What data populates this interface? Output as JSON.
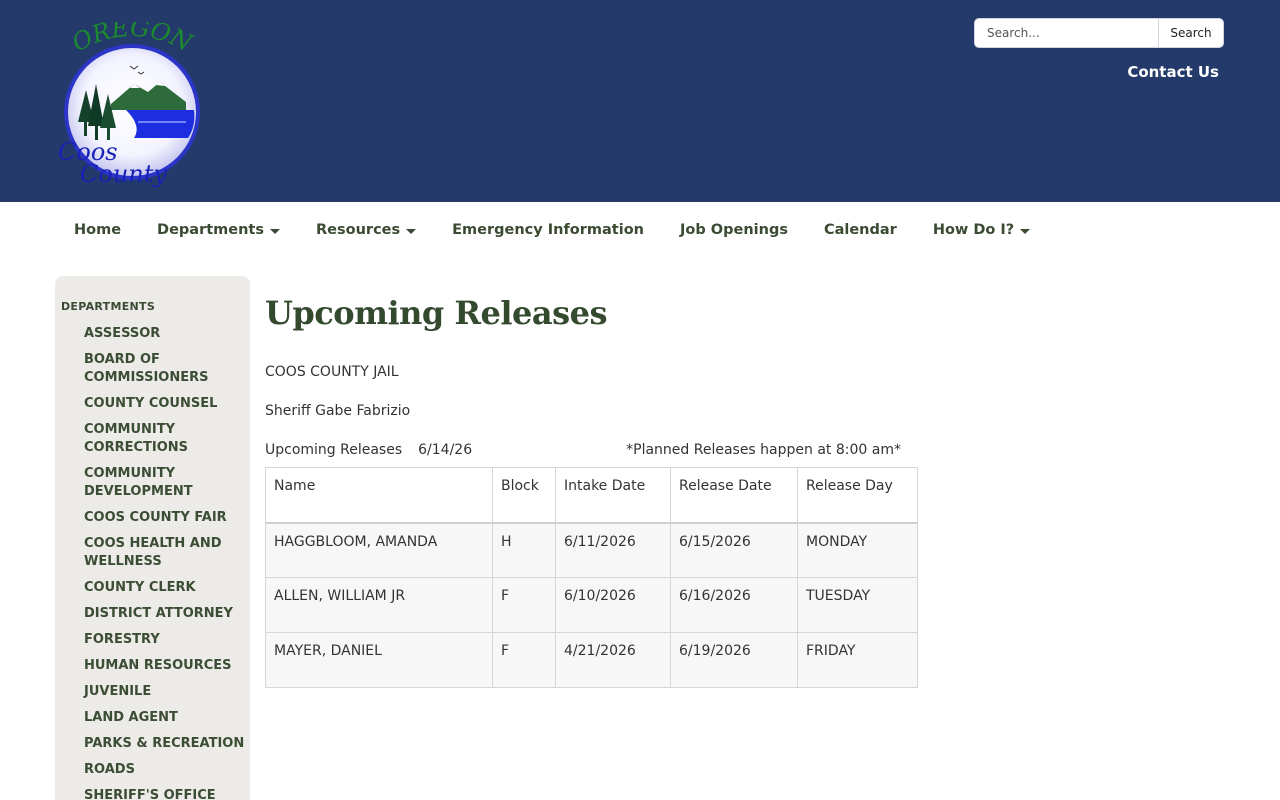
{
  "header": {
    "logo": {
      "top_text": "OREGON",
      "line1": "Coos",
      "line2": "County"
    },
    "search": {
      "placeholder": "Search...",
      "button_label": "Search"
    },
    "contact_label": "Contact Us"
  },
  "nav": {
    "items": [
      {
        "label": "Home",
        "dropdown": false
      },
      {
        "label": "Departments",
        "dropdown": true
      },
      {
        "label": "Resources",
        "dropdown": true
      },
      {
        "label": "Emergency Information",
        "dropdown": false
      },
      {
        "label": "Job Openings",
        "dropdown": false
      },
      {
        "label": "Calendar",
        "dropdown": false
      },
      {
        "label": "How Do I?",
        "dropdown": true
      }
    ]
  },
  "sidebar": {
    "title": "DEPARTMENTS",
    "items": [
      "ASSESSOR",
      "BOARD OF COMMISSIONERS",
      "COUNTY COUNSEL",
      "COMMUNITY CORRECTIONS",
      "COMMUNITY DEVELOPMENT",
      "COOS COUNTY FAIR",
      "COOS HEALTH AND WELLNESS",
      "COUNTY CLERK",
      "DISTRICT ATTORNEY",
      "FORESTRY",
      "HUMAN RESOURCES",
      "JUVENILE",
      "LAND AGENT",
      "PARKS & RECREATION",
      "ROADS",
      "SHERIFF'S OFFICE"
    ]
  },
  "main": {
    "title": "Upcoming Releases",
    "jail": "COOS COUNTY JAIL",
    "sheriff": "Sheriff Gabe Fabrizio",
    "releases_label": "Upcoming Releases",
    "releases_date": "6/14/26",
    "releases_note": "*Planned Releases happen at 8:00 am*",
    "table": {
      "headers": [
        "Name",
        "Block",
        "Intake Date",
        "Release Date",
        "Release Day"
      ],
      "rows": [
        [
          "HAGGBLOOM, AMANDA",
          "H",
          "6/11/2026",
          "6/15/2026",
          "MONDAY"
        ],
        [
          "ALLEN, WILLIAM JR",
          "F",
          "6/10/2026",
          "6/16/2026",
          "TUESDAY"
        ],
        [
          "MAYER, DANIEL",
          "F",
          "4/21/2026",
          "6/19/2026",
          "FRIDAY"
        ]
      ]
    }
  },
  "colors": {
    "header_bg": "#233a6a",
    "nav_text": "#3a4a33",
    "title_green": "#344a2f",
    "sidebar_bg": "#ecebe7"
  }
}
